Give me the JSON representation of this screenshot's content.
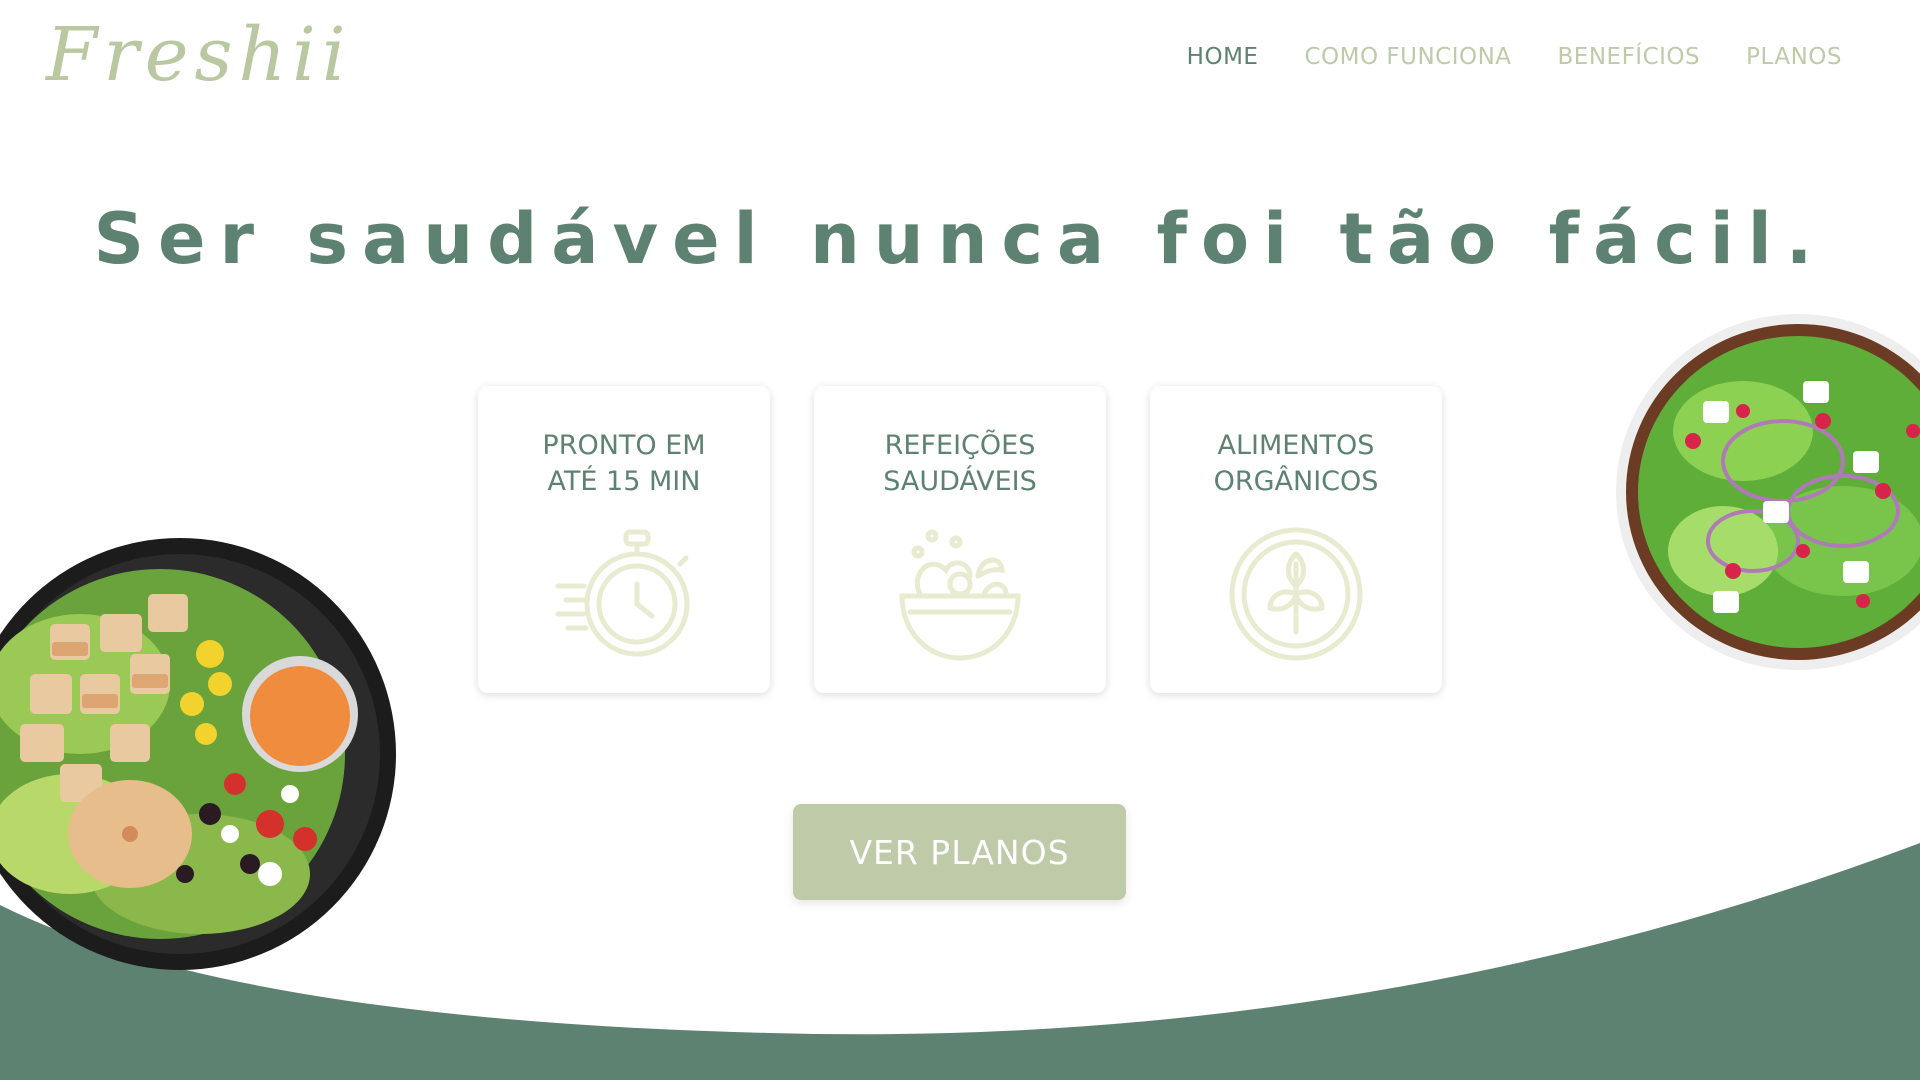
{
  "brand": {
    "logo_text": "Freshii"
  },
  "nav": {
    "items": [
      {
        "label": "HOME",
        "active": true
      },
      {
        "label": "COMO FUNCIONA",
        "active": false
      },
      {
        "label": "BENEFÍCIOS",
        "active": false
      },
      {
        "label": "PLANOS",
        "active": false
      }
    ]
  },
  "hero": {
    "headline": "Ser saudável nunca foi tão fácil.",
    "cta_label": "VER PLANOS"
  },
  "features": [
    {
      "line1": "PRONTO EM",
      "line2": "ATÉ 15 MIN",
      "icon": "stopwatch-icon"
    },
    {
      "line1": "REFEIÇÕES",
      "line2": "SAUDÁVEIS",
      "icon": "salad-bowl-icon"
    },
    {
      "line1": "ALIMENTOS",
      "line2": "ORGÂNICOS",
      "icon": "organic-leaf-icon"
    }
  ],
  "images": {
    "left": "chicken-salad-bowl-photo",
    "right": "green-salad-plate-photo"
  },
  "colors": {
    "primary_green": "#5e8272",
    "sage": "#bfcaa8",
    "icon_pale": "#e8ebcf",
    "background": "#ffffff"
  }
}
